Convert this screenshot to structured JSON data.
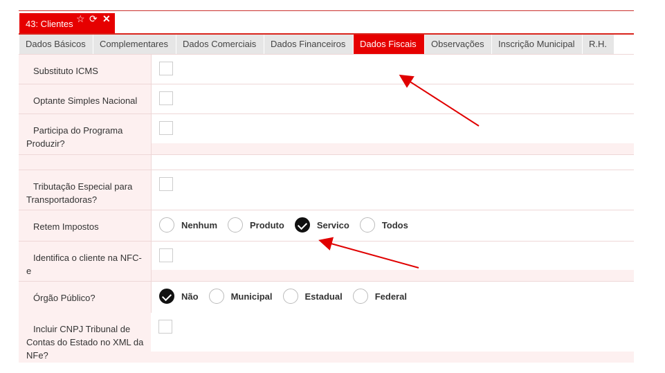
{
  "window": {
    "tab_title": "43: Clientes",
    "icons": [
      "star-icon",
      "refresh-icon",
      "close-icon"
    ]
  },
  "tabs": [
    {
      "label": "Dados Básicos",
      "active": false
    },
    {
      "label": "Complementares",
      "active": false
    },
    {
      "label": "Dados Comerciais",
      "active": false
    },
    {
      "label": "Dados Financeiros",
      "active": false
    },
    {
      "label": "Dados Fiscais",
      "active": true
    },
    {
      "label": "Observações",
      "active": false
    },
    {
      "label": "Inscrição Municipal",
      "active": false
    },
    {
      "label": "R.H.",
      "active": false
    }
  ],
  "fields": {
    "substituto_icms": {
      "label": "Substituto ICMS",
      "checked": false
    },
    "optante_simples": {
      "label": "Optante Simples Nacional",
      "checked": false
    },
    "programa_produzir": {
      "label": "Participa do Programa Produzir?",
      "checked": false
    },
    "tributacao_transportadoras": {
      "label": "Tributação Especial para Transportadoras?",
      "checked": false
    },
    "retem_impostos": {
      "label": "Retem Impostos",
      "options": [
        "Nenhum",
        "Produto",
        "Servico",
        "Todos"
      ],
      "selected": "Servico"
    },
    "identifica_nfce": {
      "label": "Identifica o cliente na NFC-e",
      "checked": false
    },
    "orgao_publico": {
      "label": "Órgão Público?",
      "options": [
        "Não",
        "Municipal",
        "Estadual",
        "Federal"
      ],
      "selected": "Não"
    },
    "cnpj_tribunal": {
      "label": "Incluir CNPJ Tribunal de Contas do Estado no XML da NFe?",
      "checked": false
    }
  },
  "colors": {
    "accent": "#e60000",
    "label_bg": "#fdf0f0",
    "annotation_arrow": "#e00000"
  }
}
